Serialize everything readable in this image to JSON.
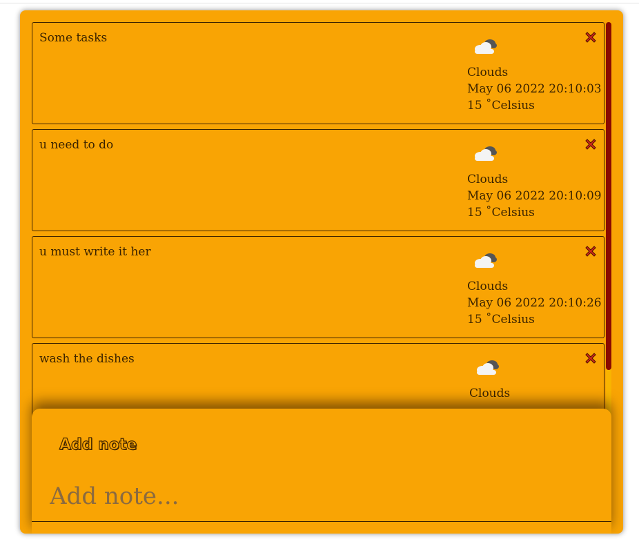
{
  "notes": [
    {
      "text": "Some tasks",
      "weather": {
        "icon": "cloud-icon",
        "description": "Clouds",
        "datetime": "May 06 2022 20:10:03",
        "temperature": "15 ˚Celsius"
      }
    },
    {
      "text": "u need to do",
      "weather": {
        "icon": "cloud-icon",
        "description": "Clouds",
        "datetime": "May 06 2022 20:10:09",
        "temperature": "15 ˚Celsius"
      }
    },
    {
      "text": "u must write it her",
      "weather": {
        "icon": "cloud-icon",
        "description": "Clouds",
        "datetime": "May 06 2022 20:10:26",
        "temperature": "15 ˚Celsius"
      }
    },
    {
      "text": "wash the dishes",
      "weather": {
        "icon": "cloud-icon",
        "description": "Clouds"
      }
    }
  ],
  "add_note": {
    "title": "Add note",
    "placeholder": "Add note..."
  },
  "colors": {
    "background": "#f9a404",
    "scrollbar_thumb": "#8a0a00",
    "delete_icon": "#d42a1a"
  }
}
